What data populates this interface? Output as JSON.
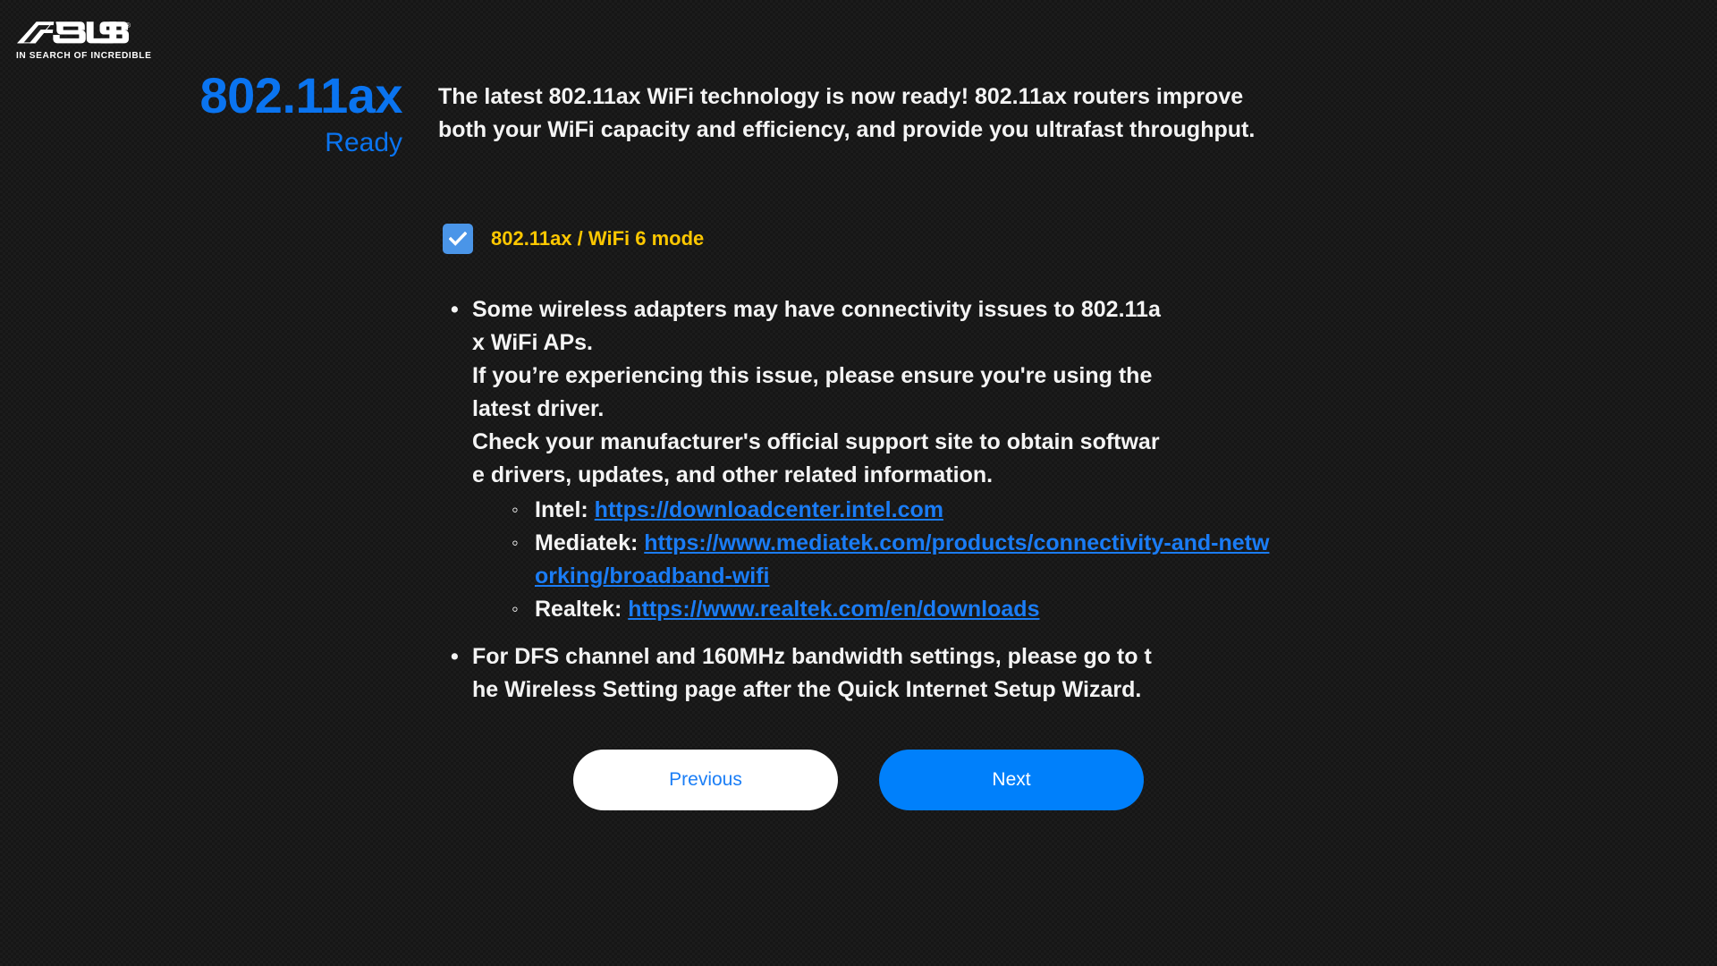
{
  "brand": {
    "name": "ASUS",
    "tagline": "IN SEARCH OF INCREDIBLE",
    "registered_mark": "®",
    "logo_icon": "asus-logo-icon"
  },
  "hero": {
    "title": "802.11ax",
    "subtitle": "Ready",
    "description": "The latest 802.11ax WiFi technology is now ready! 802.11ax routers improve both your WiFi capacity and efficiency, and provide you ultrafast throughput."
  },
  "mode_option": {
    "label": "802.11ax / WiFi 6 mode",
    "checked": true,
    "checkbox_icon": "checkmark-icon"
  },
  "notes": {
    "bullet_disc": "•",
    "bullet_circle": "◦",
    "item1": {
      "line1": "Some wireless adapters may have connectivity issues to 802.11a",
      "line2": "x WiFi APs.",
      "line3": "If you’re experiencing this issue, please ensure you're using the",
      "line4": "latest driver.",
      "line5": "Check your manufacturer's official support site to obtain softwar",
      "line6": "e drivers, updates, and other related information.",
      "vendors": [
        {
          "name": "Intel:",
          "url": "https://downloadcenter.intel.com"
        },
        {
          "name": "Mediatek:",
          "url": "https://www.mediatek.com/products/connectivity-and-networking/broadband-wifi"
        },
        {
          "name": "Realtek:",
          "url": "https://www.realtek.com/en/downloads"
        }
      ]
    },
    "item2": {
      "line1": "For DFS channel and 160MHz bandwidth settings, please go to t",
      "line2": "he Wireless Setting page after the Quick Internet Setup Wizard."
    }
  },
  "buttons": {
    "previous": "Previous",
    "next": "Next"
  },
  "colors": {
    "background": "#1e1e1e",
    "accent_blue": "#0a74f0",
    "link_blue": "#1a7cf5",
    "next_button_blue": "#0080fb",
    "highlight_yellow": "#fdc700",
    "checkbox_blue": "#4a95e8",
    "text_white": "#f4f4f4"
  }
}
